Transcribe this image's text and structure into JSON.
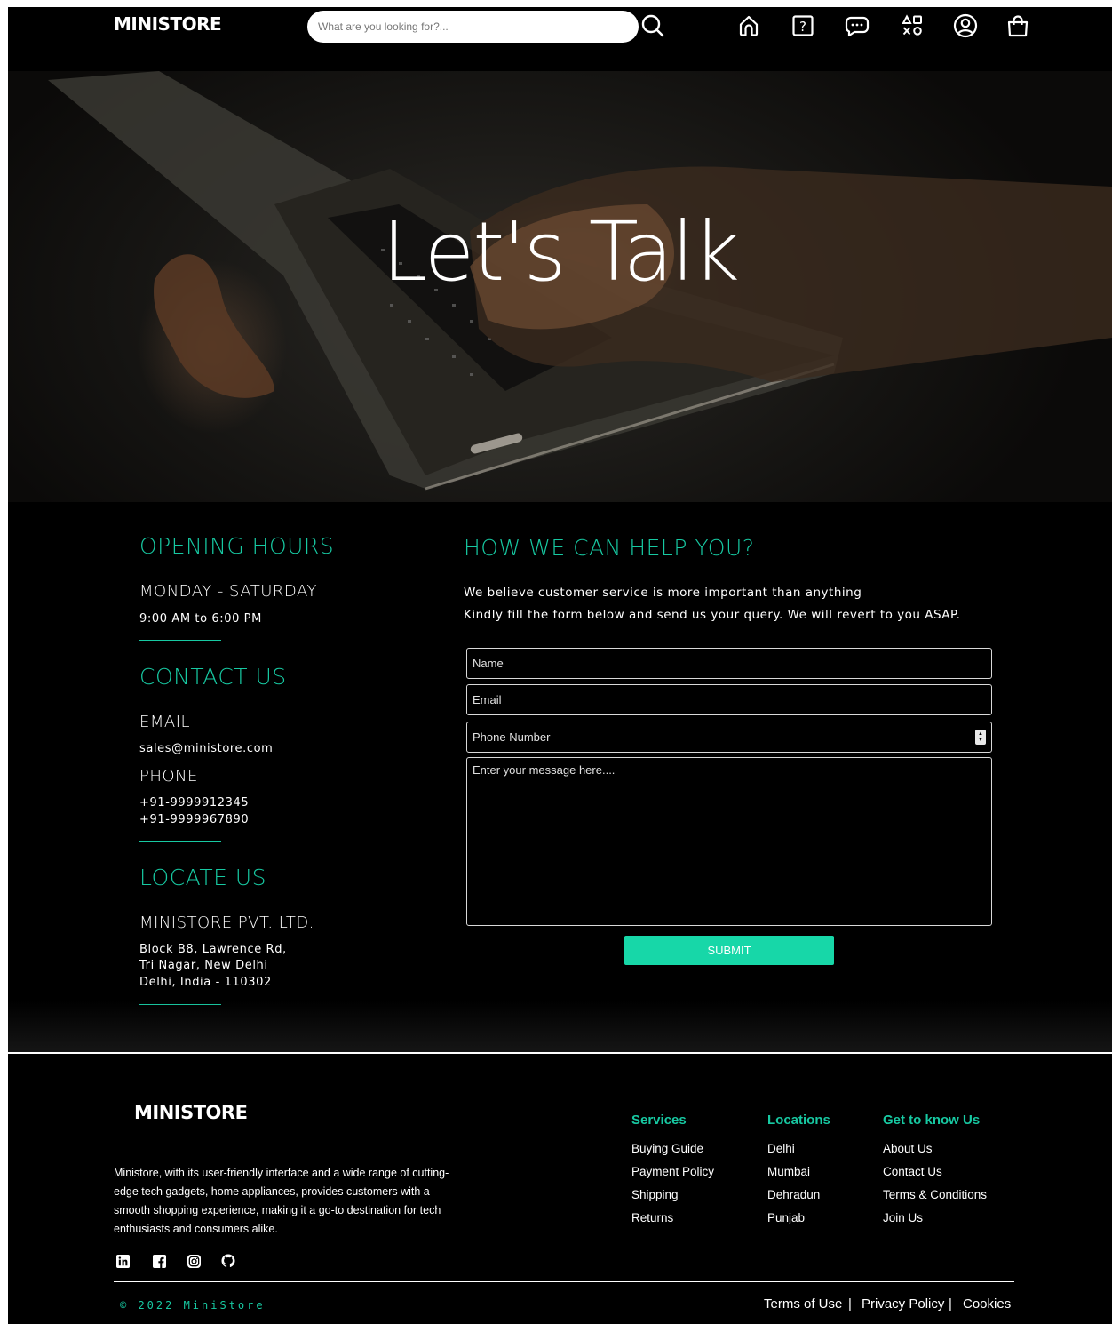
{
  "header": {
    "logo": "MINISTORE",
    "search_placeholder": "What are you looking for?...",
    "nav_icons": [
      "home-icon",
      "help-icon",
      "chat-icon",
      "categories-icon",
      "account-icon",
      "shopping-bag-icon"
    ]
  },
  "hero": {
    "title": "Let's Talk"
  },
  "hours": {
    "heading": "OPENING HOURS",
    "days": "MONDAY - SATURDAY",
    "time": "9:00 AM to 6:00 PM"
  },
  "contact": {
    "heading": "CONTACT US",
    "email_label": "EMAIL",
    "email": "sales@ministore.com",
    "phone_label": "PHONE",
    "phone1": "+91-9999912345",
    "phone2": "+91-9999967890"
  },
  "locate": {
    "heading": "LOCATE US",
    "company": "MINISTORE PVT. LTD.",
    "line1": "Block B8, Lawrence Rd,",
    "line2": "Tri Nagar, New Delhi",
    "line3": "Delhi, India - 110302"
  },
  "form": {
    "heading": "HOW WE CAN HELP YOU?",
    "intro1": "We believe customer service is more important than anything",
    "intro2": "Kindly fill the form below and send us your query. We will revert to you ASAP.",
    "name_placeholder": "Name",
    "email_placeholder": "Email",
    "phone_placeholder": "Phone Number",
    "message_placeholder": "Enter your message here....",
    "submit_label": "SUBMIT"
  },
  "footer": {
    "logo": "MINISTORE",
    "about": "Ministore, with its user-friendly interface and a wide range of cutting-edge tech gadgets, home appliances, provides customers with a smooth shopping experience, making it a go-to destination for tech enthusiasts and consumers alike.",
    "social_icons": [
      "linkedin-icon",
      "facebook-icon",
      "instagram-icon",
      "github-icon"
    ],
    "columns": [
      {
        "heading": "Services",
        "links": [
          "Buying Guide",
          "Payment Policy",
          "Shipping",
          "Returns"
        ]
      },
      {
        "heading": "Locations",
        "links": [
          "Delhi",
          "Mumbai",
          "Dehradun",
          "Punjab"
        ]
      },
      {
        "heading": "Get to know Us",
        "links": [
          "About Us",
          "Contact Us",
          "Terms & Conditions",
          "Join Us"
        ]
      }
    ],
    "copyright": "© 2022 MiniStore",
    "legal": [
      "Terms of Use",
      "Privacy Policy",
      "Cookies"
    ],
    "separator": "|"
  },
  "colors": {
    "accent": "#17c9a2",
    "button": "#17d7a8",
    "background": "#000000"
  }
}
